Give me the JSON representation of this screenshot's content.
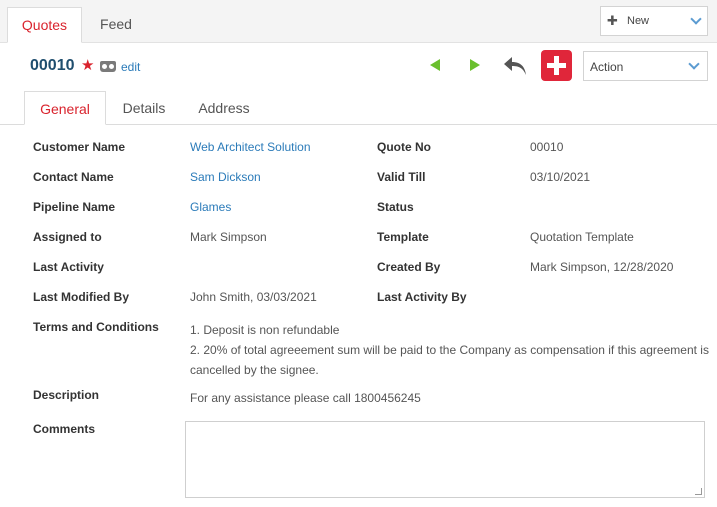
{
  "top_tabs": [
    {
      "label": "Quotes"
    },
    {
      "label": "Feed"
    }
  ],
  "new_button": {
    "label": "New"
  },
  "record": {
    "id": "00010",
    "edit_label": "edit"
  },
  "action_select": {
    "value": "Action"
  },
  "sub_tabs": [
    {
      "label": "General"
    },
    {
      "label": "Details"
    },
    {
      "label": "Address"
    }
  ],
  "fields": {
    "customer_name": {
      "label": "Customer Name",
      "value": "Web Architect Solution"
    },
    "quote_no": {
      "label": "Quote No",
      "value": "00010"
    },
    "contact_name": {
      "label": "Contact Name",
      "value": "Sam Dickson"
    },
    "valid_till": {
      "label": "Valid Till",
      "value": "03/10/2021"
    },
    "pipeline_name": {
      "label": "Pipeline Name",
      "value": "Glames"
    },
    "status": {
      "label": "Status",
      "value": ""
    },
    "assigned_to": {
      "label": "Assigned to",
      "value": "Mark Simpson"
    },
    "template": {
      "label": "Template",
      "value": "Quotation Template"
    },
    "last_activity": {
      "label": "Last Activity",
      "value": ""
    },
    "created_by": {
      "label": "Created By",
      "value": "Mark Simpson, 12/28/2020"
    },
    "last_modified_by": {
      "label": "Last Modified By",
      "value": "John Smith, 03/03/2021"
    },
    "last_activity_by": {
      "label": "Last Activity By",
      "value": ""
    },
    "terms": {
      "label": "Terms and Conditions",
      "line1": "1. Deposit is non refundable",
      "line2": "2. 20% of total agreeement sum will be paid to the Company as compensation if this agreement is cancelled by the signee."
    },
    "description": {
      "label": "Description",
      "value": "For any assistance please call 1800456245"
    },
    "comments": {
      "label": "Comments",
      "value": ""
    }
  },
  "colors": {
    "accent": "#d9232d",
    "link": "#2b7bb9",
    "id": "#1f4e6e",
    "nav_green": "#6abf2e"
  }
}
